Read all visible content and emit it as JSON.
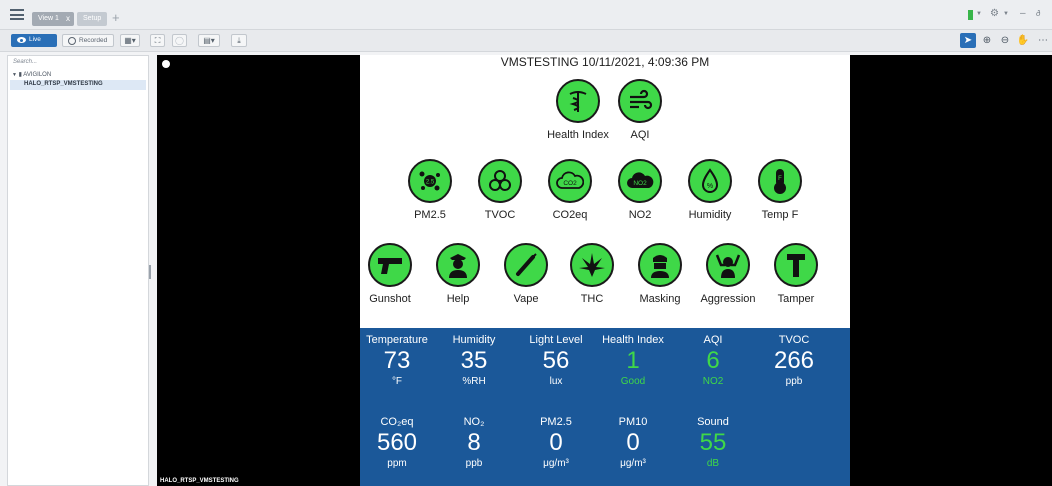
{
  "tabs": {
    "view_label": "View 1",
    "view_close": "x",
    "setup_label": "Setup",
    "add": "+"
  },
  "window_controls": {
    "minimize": "–",
    "maximize": "ð"
  },
  "toolbar": {
    "live_label": "Live",
    "recorded_label": "Recorded",
    "accent_color": "#2a6fb7"
  },
  "sidebar": {
    "search_placeholder": "Search...",
    "root_label": "AVIGILON",
    "camera_label": "HALO_RTSP_VMSTESTING"
  },
  "video": {
    "caption": "HALO_RTSP_VMSTESTING"
  },
  "dashboard": {
    "title": "VMSTESTING 10/11/2021, 4:09:36 PM",
    "icon_color": "#3fd848",
    "row1": [
      {
        "label": "Health Index",
        "icon": "caduceus-icon"
      },
      {
        "label": "AQI",
        "icon": "wind-icon"
      }
    ],
    "row2": [
      {
        "label": "PM2.5",
        "icon": "particles-icon"
      },
      {
        "label": "TVOC",
        "icon": "biohazard-icon"
      },
      {
        "label": "CO2eq",
        "icon": "co2-cloud-icon"
      },
      {
        "label": "NO2",
        "icon": "no2-cloud-icon"
      },
      {
        "label": "Humidity",
        "icon": "droplet-icon"
      },
      {
        "label": "Temp F",
        "icon": "thermometer-icon"
      }
    ],
    "row3": [
      {
        "label": "Gunshot",
        "icon": "pistol-icon"
      },
      {
        "label": "Help",
        "icon": "officer-icon"
      },
      {
        "label": "Vape",
        "icon": "vape-icon"
      },
      {
        "label": "THC",
        "icon": "cannabis-leaf-icon"
      },
      {
        "label": "Masking",
        "icon": "masked-person-icon"
      },
      {
        "label": "Aggression",
        "icon": "aggression-icon"
      },
      {
        "label": "Tamper",
        "icon": "hammer-icon"
      }
    ]
  },
  "metrics": {
    "panel_color": "#1b5899",
    "row1": [
      {
        "label": "Temperature",
        "value": "73",
        "unit": "°F"
      },
      {
        "label": "Humidity",
        "value": "35",
        "unit": "%RH"
      },
      {
        "label": "Light Level",
        "value": "56",
        "unit": "lux"
      },
      {
        "label": "Health Index",
        "value": "1",
        "unit": "Good"
      },
      {
        "label": "AQI",
        "value": "6",
        "unit": "NO2"
      },
      {
        "label": "TVOC",
        "value": "266",
        "unit": "ppb"
      }
    ],
    "row2": [
      {
        "label": "CO₂eq",
        "value": "560",
        "unit": "ppm"
      },
      {
        "label": "NO₂",
        "value": "8",
        "unit": "ppb"
      },
      {
        "label": "PM2.5",
        "value": "0",
        "unit": "μg/m³"
      },
      {
        "label": "PM10",
        "value": "0",
        "unit": "μg/m³"
      },
      {
        "label": "Sound",
        "value": "55",
        "unit": "dB"
      }
    ]
  }
}
